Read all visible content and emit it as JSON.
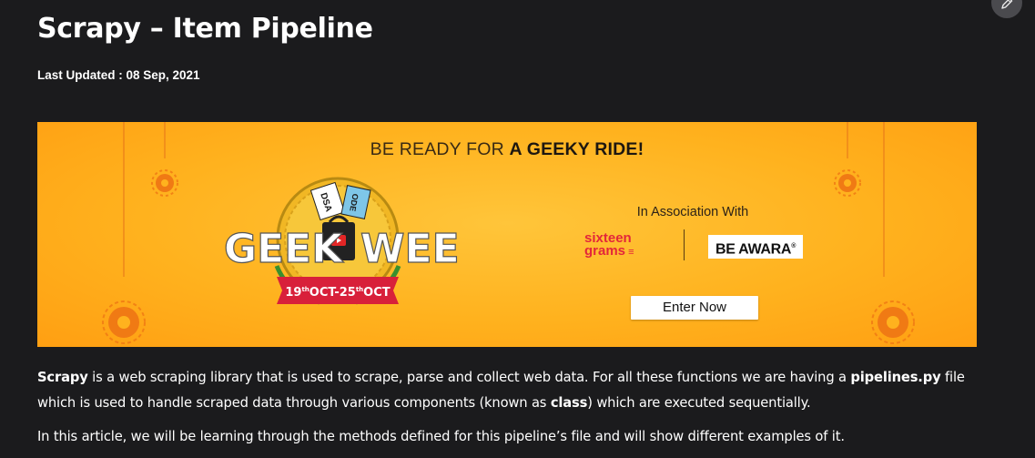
{
  "article": {
    "title": "Scrapy – Item Pipeline",
    "last_updated": "Last Updated : 08 Sep, 2021"
  },
  "banner": {
    "headline_prefix": "BE READY FOR ",
    "headline_emphasis": "A GEEKY RIDE!",
    "logo_left": "GEEK",
    "logo_right": "WEEK",
    "ticket_1": "DSA",
    "ticket_2": "ODE",
    "dates": "19",
    "dates_sup_1": "th",
    "dates_mid": "OCT-25",
    "dates_sup_2": "th",
    "dates_end": "OCT",
    "association": "In Association With",
    "sponsor_1_line1": "sixteen",
    "sponsor_1_line2": "grams",
    "sponsor_2": "BE AWARA",
    "cta": "Enter Now"
  },
  "paragraph_1": {
    "t1": "Scrapy",
    "t2": " is a web scraping library that is used to scrape, parse and collect web data. For all these functions we are having a ",
    "t3": "pipelines.py",
    "t4": " file which is used to handle scraped data through various components (known as ",
    "t5": "class",
    "t6": ") which are executed sequentially."
  },
  "paragraph_2": "In this article, we will be learning through the methods defined for this pipeline’s file and will show different examples of it.",
  "icons": {
    "edit": "pencil-icon"
  },
  "colors": {
    "background": "#1b1b1d",
    "banner_orange": "#ffb21e",
    "ribbon_red": "#d8203a",
    "logo_green": "#3a8f2e",
    "text": "#ffffff"
  }
}
